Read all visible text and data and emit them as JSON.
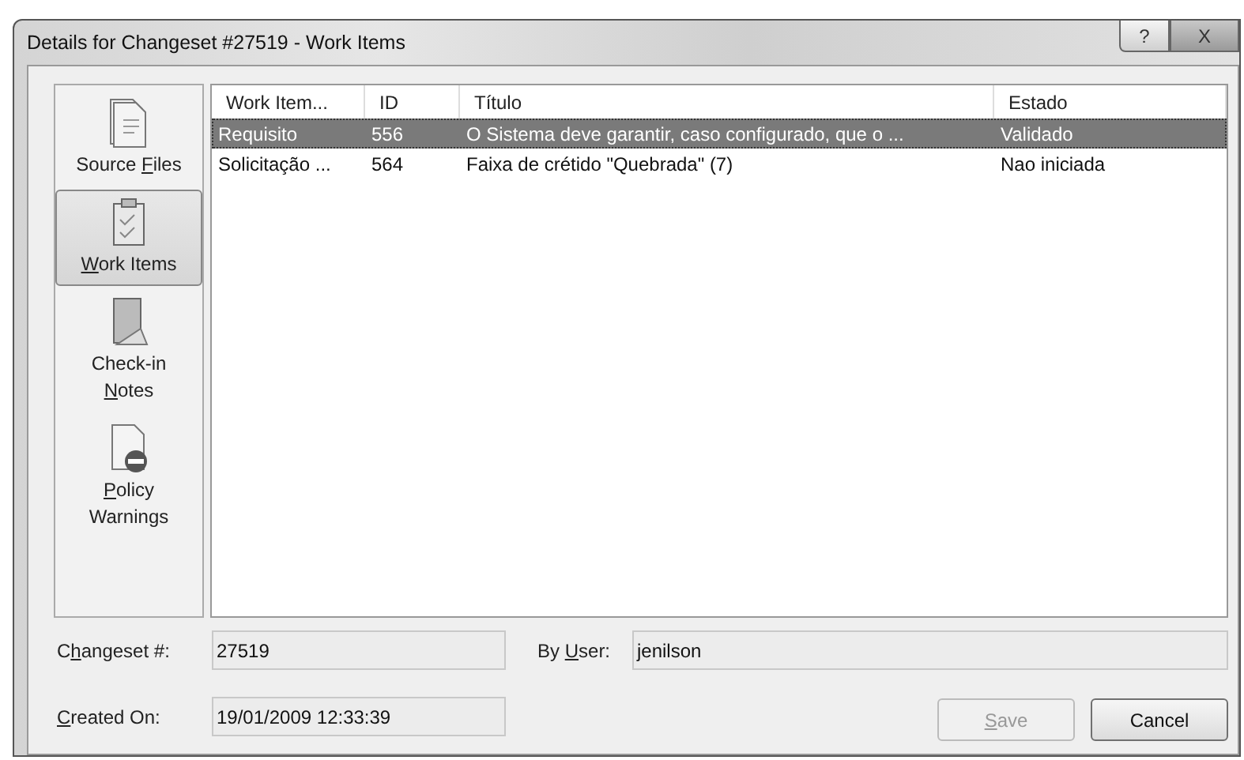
{
  "window": {
    "title": "Details for Changeset #27519 - Work Items",
    "controls": [
      {
        "kind": "help",
        "label": "?"
      },
      {
        "kind": "close",
        "label": "X"
      }
    ]
  },
  "sidebar": {
    "items": [
      {
        "kind": "files",
        "before": "Source ",
        "key": "F",
        "after": "iles",
        "selected": false
      },
      {
        "kind": "workitems",
        "key": "W",
        "after": "ork Items",
        "selected": true
      },
      {
        "kind": "notes",
        "before": "Check-in\n",
        "key": "N",
        "after": "otes",
        "selected": false
      },
      {
        "kind": "policy",
        "key": "P",
        "after": "olicy\nWarnings",
        "selected": false
      }
    ]
  },
  "table": {
    "columns": [
      "Work Item...",
      "ID",
      "Título",
      "Estado"
    ],
    "rows": [
      {
        "cells": [
          "Requisito",
          "556",
          "O Sistema deve garantir, caso configurado, que o ...",
          "Validado"
        ],
        "selected": true
      },
      {
        "cells": [
          "Solicitação ...",
          "564",
          "Faixa de crétido \"Quebrada\" (7)",
          "Nao iniciada"
        ],
        "selected": false
      }
    ]
  },
  "fields": [
    {
      "before": "C",
      "key": "h",
      "after": "angeset #:",
      "value": "27519"
    },
    {
      "before": "By ",
      "key": "U",
      "after": "ser:",
      "value": "jenilson"
    },
    {
      "key": "C",
      "after": "reated On:",
      "value": "19/01/2009 12:33:39"
    }
  ],
  "buttons": [
    {
      "key": "S",
      "after": "ave",
      "disabled": true
    },
    {
      "before": "Cancel",
      "disabled": false
    }
  ]
}
